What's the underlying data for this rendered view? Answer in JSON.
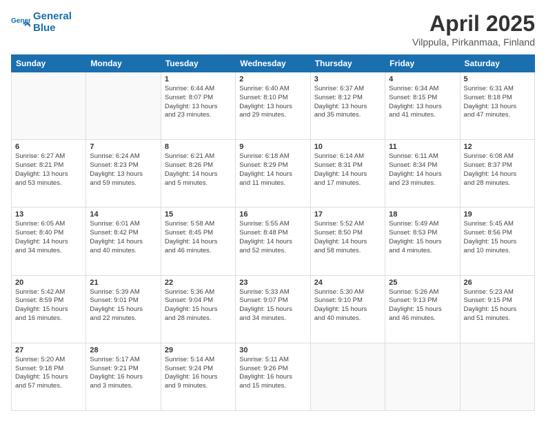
{
  "logo": {
    "line1": "General",
    "line2": "Blue"
  },
  "title": "April 2025",
  "location": "Vilppula, Pirkanmaa, Finland",
  "days_of_week": [
    "Sunday",
    "Monday",
    "Tuesday",
    "Wednesday",
    "Thursday",
    "Friday",
    "Saturday"
  ],
  "weeks": [
    [
      {
        "day": "",
        "detail": ""
      },
      {
        "day": "",
        "detail": ""
      },
      {
        "day": "1",
        "detail": "Sunrise: 6:44 AM\nSunset: 8:07 PM\nDaylight: 13 hours\nand 23 minutes."
      },
      {
        "day": "2",
        "detail": "Sunrise: 6:40 AM\nSunset: 8:10 PM\nDaylight: 13 hours\nand 29 minutes."
      },
      {
        "day": "3",
        "detail": "Sunrise: 6:37 AM\nSunset: 8:12 PM\nDaylight: 13 hours\nand 35 minutes."
      },
      {
        "day": "4",
        "detail": "Sunrise: 6:34 AM\nSunset: 8:15 PM\nDaylight: 13 hours\nand 41 minutes."
      },
      {
        "day": "5",
        "detail": "Sunrise: 6:31 AM\nSunset: 8:18 PM\nDaylight: 13 hours\nand 47 minutes."
      }
    ],
    [
      {
        "day": "6",
        "detail": "Sunrise: 6:27 AM\nSunset: 8:21 PM\nDaylight: 13 hours\nand 53 minutes."
      },
      {
        "day": "7",
        "detail": "Sunrise: 6:24 AM\nSunset: 8:23 PM\nDaylight: 13 hours\nand 59 minutes."
      },
      {
        "day": "8",
        "detail": "Sunrise: 6:21 AM\nSunset: 8:26 PM\nDaylight: 14 hours\nand 5 minutes."
      },
      {
        "day": "9",
        "detail": "Sunrise: 6:18 AM\nSunset: 8:29 PM\nDaylight: 14 hours\nand 11 minutes."
      },
      {
        "day": "10",
        "detail": "Sunrise: 6:14 AM\nSunset: 8:31 PM\nDaylight: 14 hours\nand 17 minutes."
      },
      {
        "day": "11",
        "detail": "Sunrise: 6:11 AM\nSunset: 8:34 PM\nDaylight: 14 hours\nand 23 minutes."
      },
      {
        "day": "12",
        "detail": "Sunrise: 6:08 AM\nSunset: 8:37 PM\nDaylight: 14 hours\nand 28 minutes."
      }
    ],
    [
      {
        "day": "13",
        "detail": "Sunrise: 6:05 AM\nSunset: 8:40 PM\nDaylight: 14 hours\nand 34 minutes."
      },
      {
        "day": "14",
        "detail": "Sunrise: 6:01 AM\nSunset: 8:42 PM\nDaylight: 14 hours\nand 40 minutes."
      },
      {
        "day": "15",
        "detail": "Sunrise: 5:58 AM\nSunset: 8:45 PM\nDaylight: 14 hours\nand 46 minutes."
      },
      {
        "day": "16",
        "detail": "Sunrise: 5:55 AM\nSunset: 8:48 PM\nDaylight: 14 hours\nand 52 minutes."
      },
      {
        "day": "17",
        "detail": "Sunrise: 5:52 AM\nSunset: 8:50 PM\nDaylight: 14 hours\nand 58 minutes."
      },
      {
        "day": "18",
        "detail": "Sunrise: 5:49 AM\nSunset: 8:53 PM\nDaylight: 15 hours\nand 4 minutes."
      },
      {
        "day": "19",
        "detail": "Sunrise: 5:45 AM\nSunset: 8:56 PM\nDaylight: 15 hours\nand 10 minutes."
      }
    ],
    [
      {
        "day": "20",
        "detail": "Sunrise: 5:42 AM\nSunset: 8:59 PM\nDaylight: 15 hours\nand 16 minutes."
      },
      {
        "day": "21",
        "detail": "Sunrise: 5:39 AM\nSunset: 9:01 PM\nDaylight: 15 hours\nand 22 minutes."
      },
      {
        "day": "22",
        "detail": "Sunrise: 5:36 AM\nSunset: 9:04 PM\nDaylight: 15 hours\nand 28 minutes."
      },
      {
        "day": "23",
        "detail": "Sunrise: 5:33 AM\nSunset: 9:07 PM\nDaylight: 15 hours\nand 34 minutes."
      },
      {
        "day": "24",
        "detail": "Sunrise: 5:30 AM\nSunset: 9:10 PM\nDaylight: 15 hours\nand 40 minutes."
      },
      {
        "day": "25",
        "detail": "Sunrise: 5:26 AM\nSunset: 9:13 PM\nDaylight: 15 hours\nand 46 minutes."
      },
      {
        "day": "26",
        "detail": "Sunrise: 5:23 AM\nSunset: 9:15 PM\nDaylight: 15 hours\nand 51 minutes."
      }
    ],
    [
      {
        "day": "27",
        "detail": "Sunrise: 5:20 AM\nSunset: 9:18 PM\nDaylight: 15 hours\nand 57 minutes."
      },
      {
        "day": "28",
        "detail": "Sunrise: 5:17 AM\nSunset: 9:21 PM\nDaylight: 16 hours\nand 3 minutes."
      },
      {
        "day": "29",
        "detail": "Sunrise: 5:14 AM\nSunset: 9:24 PM\nDaylight: 16 hours\nand 9 minutes."
      },
      {
        "day": "30",
        "detail": "Sunrise: 5:11 AM\nSunset: 9:26 PM\nDaylight: 16 hours\nand 15 minutes."
      },
      {
        "day": "",
        "detail": ""
      },
      {
        "day": "",
        "detail": ""
      },
      {
        "day": "",
        "detail": ""
      }
    ]
  ]
}
